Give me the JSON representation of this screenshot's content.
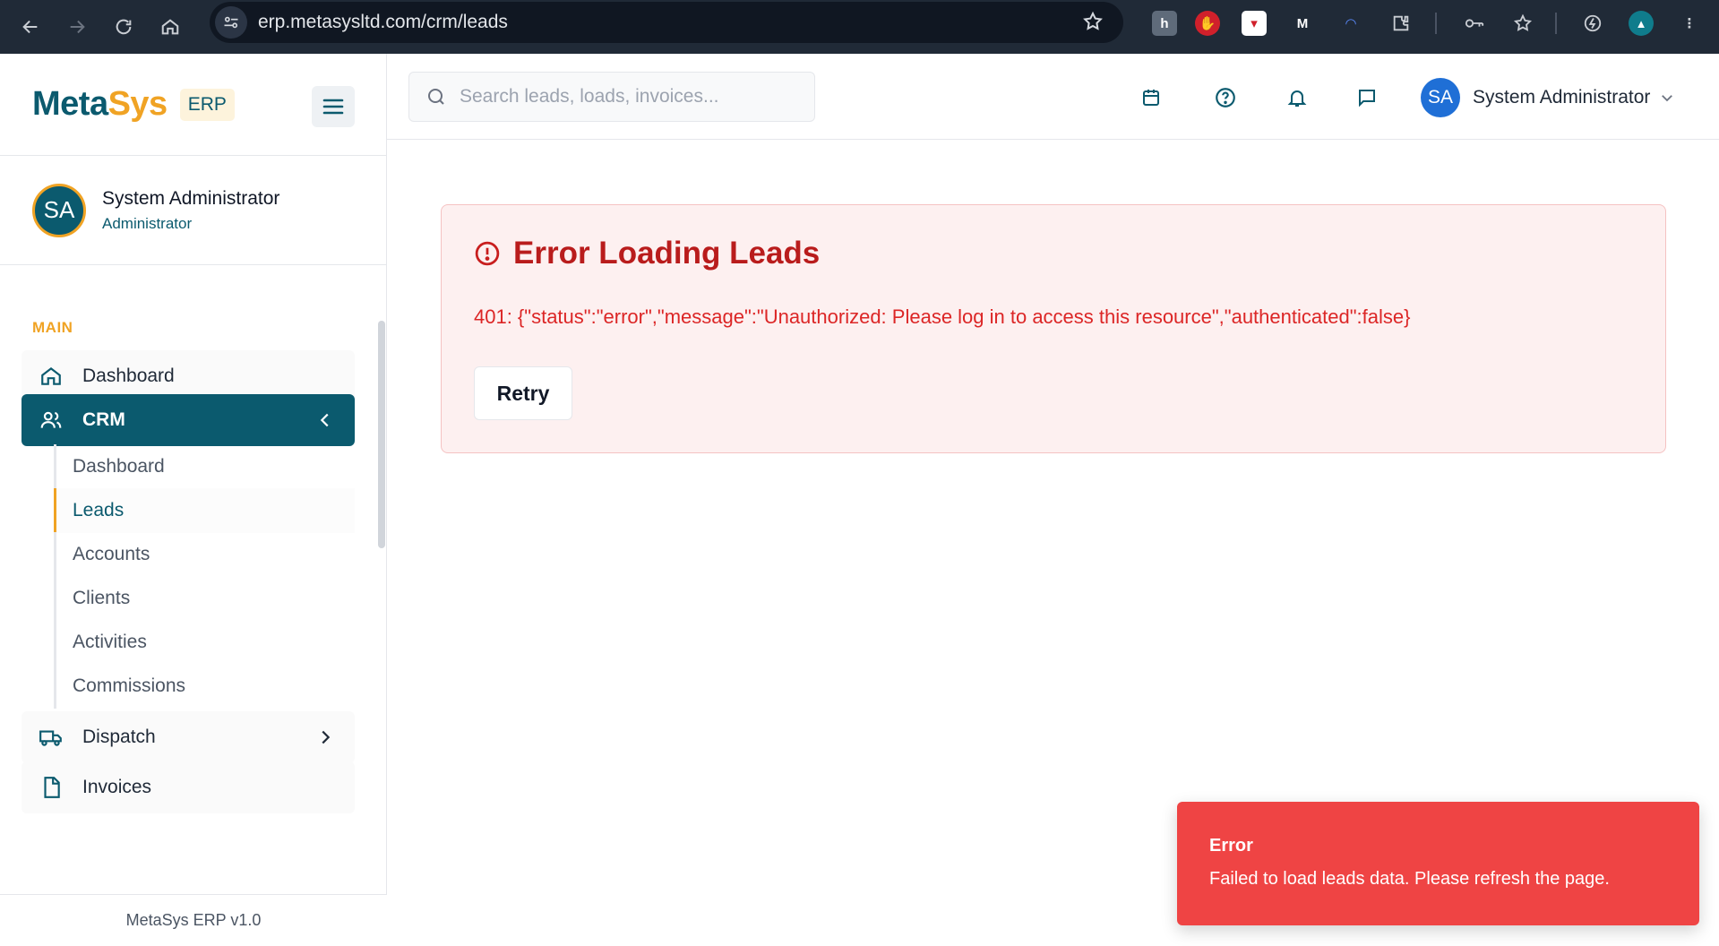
{
  "browser": {
    "url": "erp.metasysltd.com/crm/leads"
  },
  "brand": {
    "name_part1": "Meta",
    "name_part2": "Sys",
    "tag": "ERP"
  },
  "profile": {
    "initials": "SA",
    "name": "System Administrator",
    "role": "Administrator"
  },
  "sidebar": {
    "section_label": "MAIN",
    "items": [
      {
        "label": "Dashboard",
        "icon": "home-icon"
      },
      {
        "label": "CRM",
        "icon": "users-icon",
        "active": true
      },
      {
        "label": "Dispatch",
        "icon": "truck-icon"
      },
      {
        "label": "Invoices",
        "icon": "file-icon"
      }
    ],
    "crm_subitems": [
      {
        "label": "Dashboard"
      },
      {
        "label": "Leads",
        "active": true
      },
      {
        "label": "Accounts"
      },
      {
        "label": "Clients"
      },
      {
        "label": "Activities"
      },
      {
        "label": "Commissions"
      }
    ],
    "footer": "MetaSys ERP v1.0"
  },
  "topbar": {
    "search_placeholder": "Search leads, loads, invoices...",
    "icons": [
      "calendar-icon",
      "help-icon",
      "bell-icon",
      "message-icon"
    ],
    "user_initials": "SA",
    "user_name": "System Administrator"
  },
  "error": {
    "title": "Error Loading Leads",
    "message": "401: {\"status\":\"error\",\"message\":\"Unauthorized: Please log in to access this resource\",\"authenticated\":false}",
    "retry_label": "Retry"
  },
  "toast": {
    "title": "Error",
    "message": "Failed to load leads data. Please refresh the page."
  },
  "colors": {
    "brand_primary": "#0b5a6e",
    "brand_accent": "#f0a324",
    "error_text": "#b91c1c",
    "toast_bg": "#ef4444"
  }
}
